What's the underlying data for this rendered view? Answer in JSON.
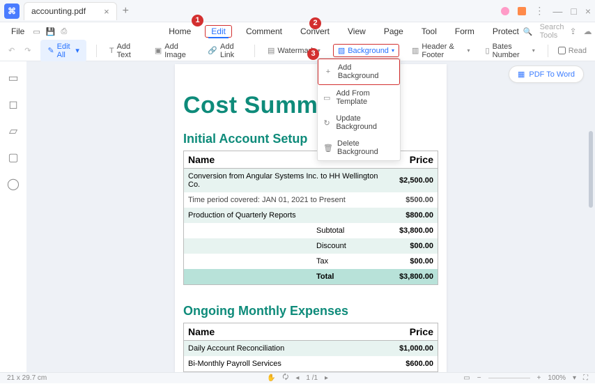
{
  "titlebar": {
    "filename": "accounting.pdf"
  },
  "menubar": {
    "file": "File",
    "items": [
      "Home",
      "Edit",
      "Comment",
      "Convert",
      "View",
      "Page",
      "Tool",
      "Form",
      "Protect"
    ],
    "active_index": 1,
    "search_placeholder": "Search Tools"
  },
  "toolbar": {
    "edit_all": "Edit All",
    "add_text": "Add Text",
    "add_image": "Add Image",
    "add_link": "Add Link",
    "watermark": "Watermark",
    "background": "Background",
    "header_footer": "Header & Footer",
    "bates_number": "Bates Number",
    "read": "Read"
  },
  "dropdown": {
    "items": [
      "Add Background",
      "Add From Template",
      "Update Background",
      "Delete Background"
    ],
    "active_index": 0
  },
  "badges": {
    "b1": "1",
    "b2": "2",
    "b3": "3"
  },
  "pdf_to_word": "PDF To Word",
  "doc": {
    "title": "Cost Summary",
    "section1": {
      "heading": "Initial Account Setup",
      "col_name": "Name",
      "col_price": "Price",
      "rows": [
        {
          "name": "Conversion from Angular Systems Inc. to HH Wellington Co.",
          "price": "$2,500.00"
        },
        {
          "name": "Time period covered: JAN 01, 2021 to Present",
          "price": "$500.00"
        },
        {
          "name": "Production of Quarterly Reports",
          "price": "$800.00"
        }
      ],
      "summary": [
        {
          "label": "Subtotal",
          "value": "$3,800.00"
        },
        {
          "label": "Discount",
          "value": "$00.00"
        },
        {
          "label": "Tax",
          "value": "$00.00"
        },
        {
          "label": "Total",
          "value": "$3,800.00"
        }
      ]
    },
    "section2": {
      "heading": "Ongoing Monthly Expenses",
      "col_name": "Name",
      "col_price": "Price",
      "rows": [
        {
          "name": "Daily Account Reconciliation",
          "price": "$1,000.00"
        },
        {
          "name": "Bi-Monthly Payroll Services",
          "price": "$600.00"
        }
      ]
    }
  },
  "status": {
    "dims": "21 x 29.7 cm",
    "page": "1",
    "pages": "/1",
    "zoom": "100%"
  }
}
